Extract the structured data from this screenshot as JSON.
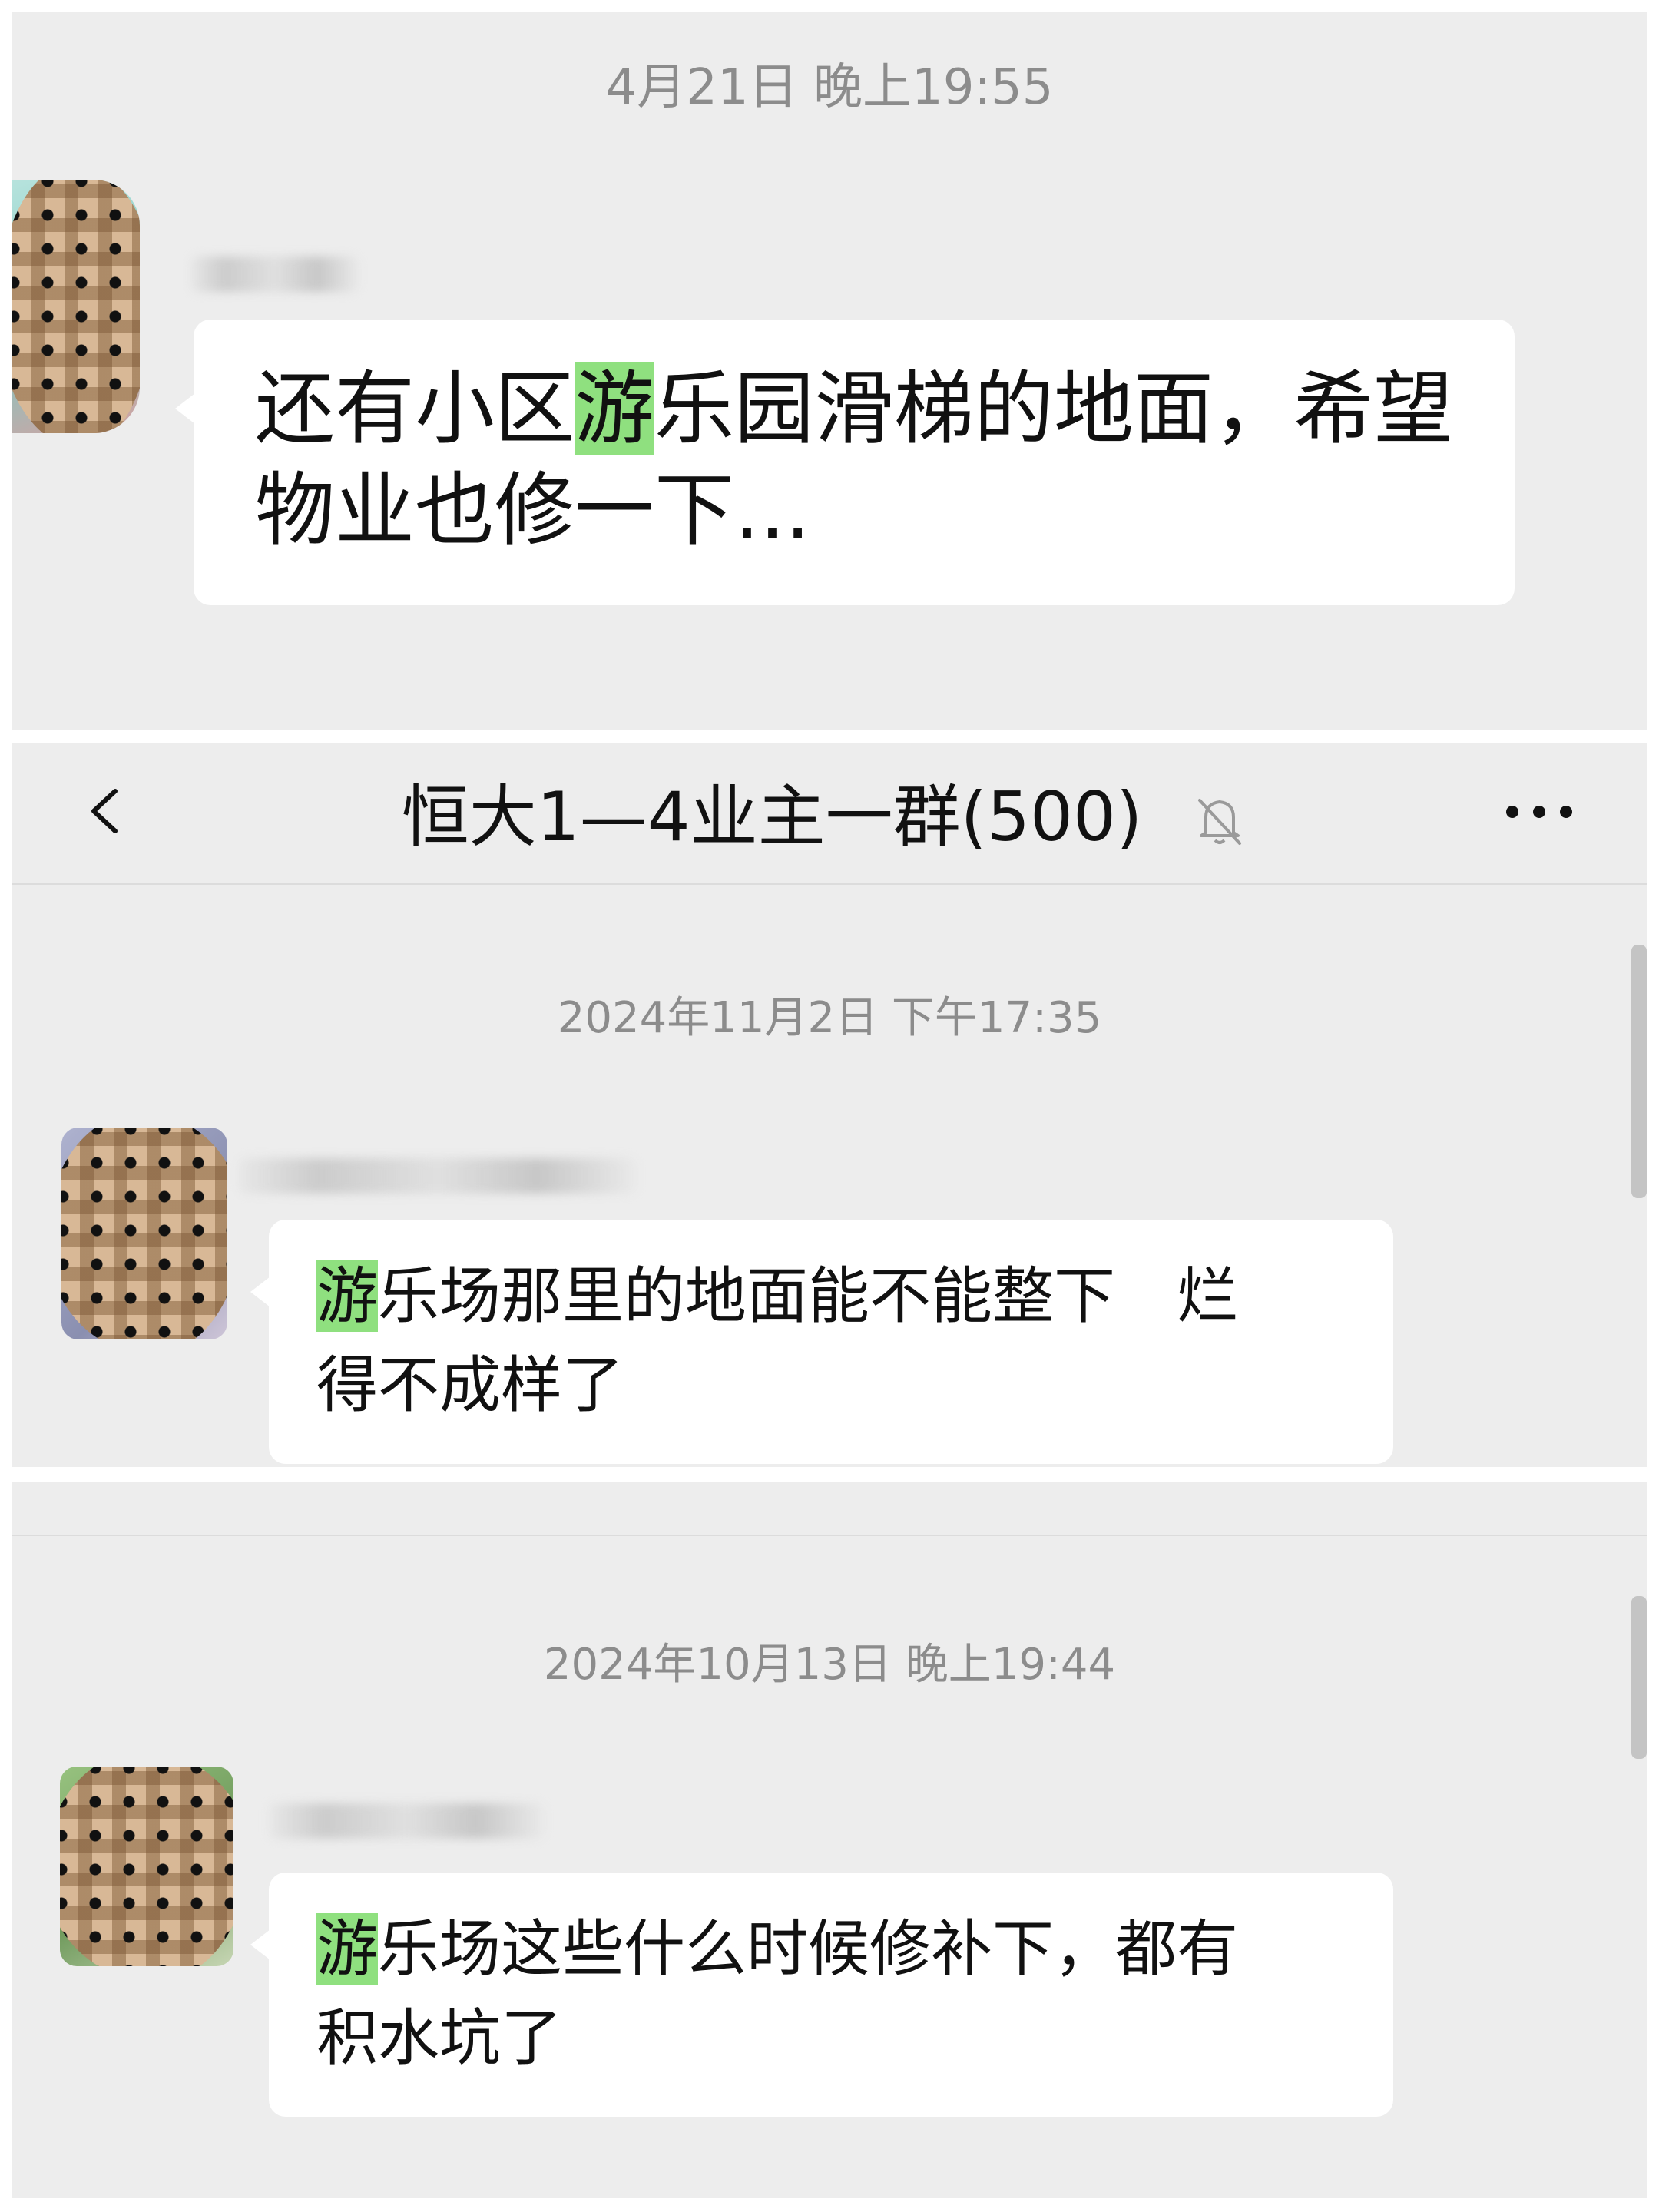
{
  "screenshot_1": {
    "timestamp": "4月21日 晚上19:55",
    "message": {
      "line1_pre": "还有小区",
      "line1_hl": "游",
      "line1_post": "乐园滑梯的地面，希望",
      "line2": "物业也修一下..."
    },
    "colors": {
      "avatar_tint": "#7fc9c2"
    }
  },
  "screenshot_2": {
    "header": {
      "back": "back-chevron-icon",
      "title": "恒大1—4业主一群(500)",
      "muted": "bell-muted-icon",
      "more": "more-dots-icon"
    },
    "timestamp": "2024年11月2日 下午17:35",
    "message": {
      "line1_hl": "游",
      "line1_post": "乐场那里的地面能不能整下　烂",
      "line2": "得不成样了"
    },
    "colors": {
      "avatar_tint": "#8a8fb0"
    }
  },
  "screenshot_3": {
    "timestamp": "2024年10月13日 晚上19:44",
    "message": {
      "line1_hl": "游",
      "line1_post": "乐场这些什么时候修补下，都有",
      "line2": "积水坑了"
    },
    "colors": {
      "avatar_tint": "#6f9a5c"
    }
  },
  "style": {
    "panel_bg": "#ededed",
    "bubble_bg": "#ffffff",
    "highlight": "#8fe07f",
    "timestamp_color": "#8c8c8c"
  }
}
